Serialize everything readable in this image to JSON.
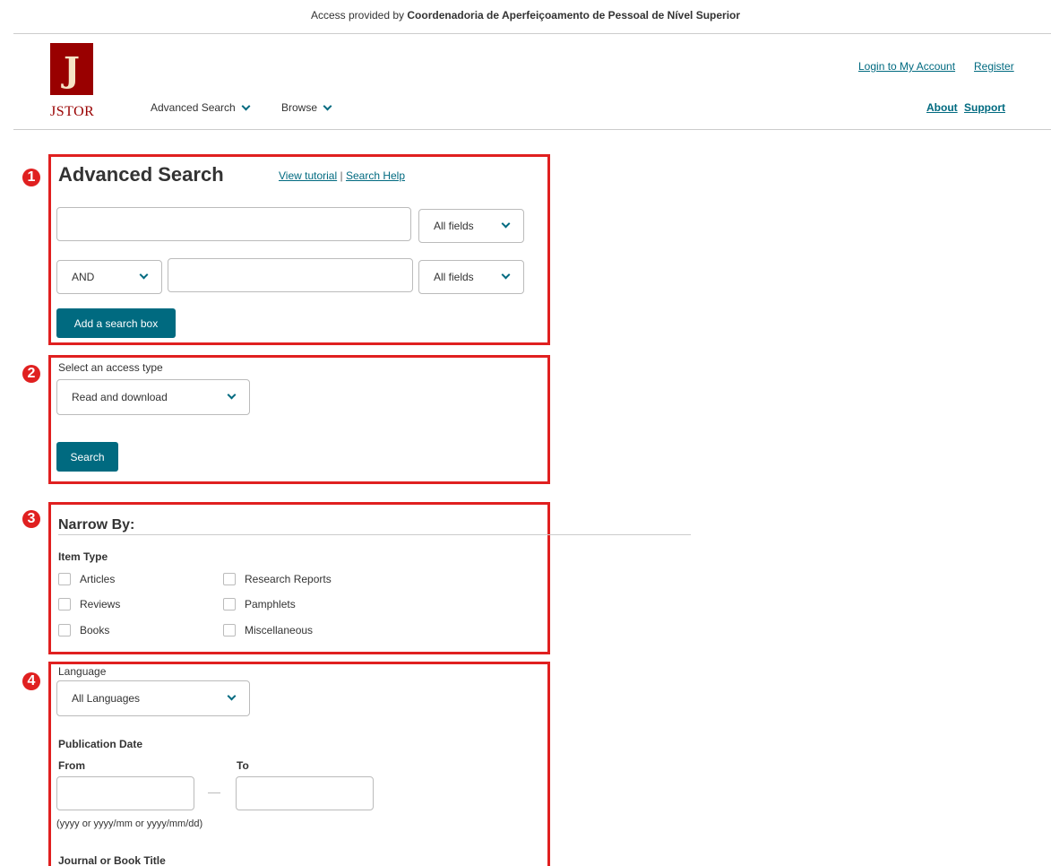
{
  "access_bar": {
    "prefix": "Access provided by",
    "institution": "Coordenadoria de Aperfeiçoamento de Pessoal de Nível Superior"
  },
  "header": {
    "logo_text": "JSTOR",
    "nav": [
      {
        "label": "Advanced Search"
      },
      {
        "label": "Browse"
      }
    ],
    "account_links": {
      "login": "Login to My Account",
      "register": "Register"
    },
    "info_links": {
      "about": "About",
      "support": "Support"
    }
  },
  "annotation_badges": [
    "1",
    "2",
    "3",
    "4"
  ],
  "search_section": {
    "title": "Advanced Search",
    "view_tutorial": "View tutorial",
    "separator": "|",
    "search_help": "Search Help",
    "row1": {
      "query_value": "",
      "field_select": "All fields"
    },
    "row2": {
      "operator_select": "AND",
      "query_value": "",
      "field_select": "All fields"
    },
    "add_box_button": "Add a search box"
  },
  "access_section": {
    "label": "Select an access type",
    "selected": "Read and download",
    "search_button": "Search"
  },
  "narrow_section": {
    "title": "Narrow By:",
    "item_type_label": "Item Type",
    "item_types": [
      {
        "label": "Articles",
        "checked": false
      },
      {
        "label": "Reviews",
        "checked": false
      },
      {
        "label": "Books",
        "checked": false
      },
      {
        "label": "Research Reports",
        "checked": false
      },
      {
        "label": "Pamphlets",
        "checked": false
      },
      {
        "label": "Miscellaneous",
        "checked": false
      }
    ]
  },
  "filters_section": {
    "language_label": "Language",
    "language_selected": "All Languages",
    "pub_date_label": "Publication Date",
    "from_label": "From",
    "to_label": "To",
    "from_value": "",
    "to_value": "",
    "date_hint": "(yyyy or yyyy/mm or yyyy/mm/dd)",
    "journal_label": "Journal or Book Title"
  },
  "colors": {
    "accent": "#006a80",
    "brand": "#990000",
    "annotation": "#e02020"
  }
}
